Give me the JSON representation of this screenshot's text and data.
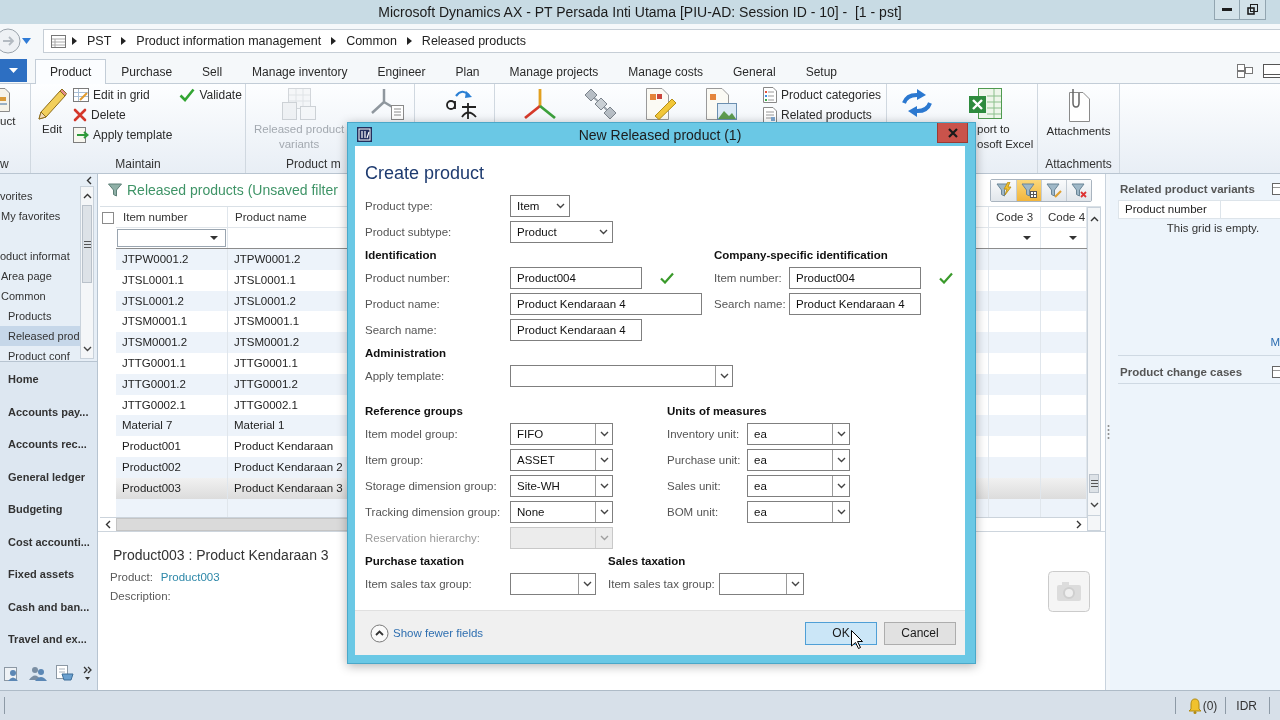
{
  "window": {
    "title": "Microsoft Dynamics AX - PT Persada Inti Utama [PIU-AD: Session ID - 10] -  [1 - pst]"
  },
  "address_bar": {
    "breadcrumb": [
      "PST",
      "Product information management",
      "Common",
      "Released products"
    ]
  },
  "ribbon": {
    "tabs": [
      {
        "label": "Product",
        "selected": true
      },
      {
        "label": "Purchase",
        "selected": false
      },
      {
        "label": "Sell",
        "selected": false
      },
      {
        "label": "Manage inventory",
        "selected": false
      },
      {
        "label": "Engineer",
        "selected": false
      },
      {
        "label": "Plan",
        "selected": false
      },
      {
        "label": "Manage projects",
        "selected": false
      },
      {
        "label": "Manage costs",
        "selected": false
      },
      {
        "label": "General",
        "selected": false
      },
      {
        "label": "Setup",
        "selected": false
      }
    ],
    "groups": [
      {
        "label": "w",
        "items": [
          {
            "kind": "large",
            "label": "uct",
            "disabled": false
          }
        ]
      },
      {
        "label": "Maintain",
        "items": [
          {
            "kind": "large",
            "label": "Edit",
            "disabled": false
          },
          {
            "kind": "small",
            "label": "Edit in grid",
            "disabled": false
          },
          {
            "kind": "small",
            "label": "Delete",
            "disabled": false
          },
          {
            "kind": "small",
            "label": "Apply template",
            "disabled": false
          },
          {
            "kind": "small",
            "label": "Validate",
            "disabled": false
          }
        ]
      },
      {
        "label": "Product m",
        "items": [
          {
            "kind": "large",
            "label": "Released product\nvariants",
            "disabled": true
          },
          {
            "kind": "icon",
            "disabled": false
          }
        ]
      },
      {
        "items": [
          {
            "kind": "icon",
            "disabled": false
          }
        ]
      },
      {
        "items": [
          {
            "kind": "icon",
            "disabled": false
          },
          {
            "kind": "icon",
            "disabled": false
          },
          {
            "kind": "icon",
            "disabled": false
          },
          {
            "kind": "icon",
            "disabled": false
          },
          {
            "kind": "small",
            "label": "Product categories",
            "disabled": false
          },
          {
            "kind": "small",
            "label": "Related products",
            "disabled": false
          }
        ]
      },
      {
        "items": [
          {
            "kind": "icon",
            "disabled": false
          },
          {
            "kind": "large",
            "label": "port to\nosoft Excel",
            "disabled": false
          }
        ]
      },
      {
        "label": "Attachments",
        "items": [
          {
            "kind": "large",
            "label": "Attachments",
            "disabled": false
          }
        ]
      }
    ]
  },
  "nav_pane": {
    "tree": [
      {
        "label": "vorites",
        "selected": false,
        "children": [
          {
            "label": "My favorites",
            "selected": false
          }
        ]
      },
      {
        "label": "oduct informat",
        "selected": false,
        "children": [
          {
            "label": "Area page",
            "selected": false
          },
          {
            "label": "Common",
            "selected": false,
            "children": [
              {
                "label": "Products",
                "selected": false
              },
              {
                "label": "Released prod",
                "selected": true
              },
              {
                "label": "Product conf",
                "selected": false
              }
            ]
          }
        ]
      }
    ],
    "modules": [
      "Home",
      "Accounts pay...",
      "Accounts rec...",
      "General ledger",
      "Budgeting",
      "Cost accounti...",
      "Fixed assets",
      "Cash and ban...",
      "Travel and ex..."
    ]
  },
  "grid": {
    "title": "Released products (Unsaved filter",
    "filter_buttons": [
      {
        "on": false
      },
      {
        "on": true
      },
      {
        "on": false
      },
      {
        "on": false
      }
    ],
    "select_all_checked": false,
    "columns": [
      "Item number",
      "Product name",
      "Code 3",
      "Code 4"
    ],
    "rows": [
      {
        "cells": [
          "JTPW0001.2",
          "JTPW0001.2"
        ],
        "selected": false
      },
      {
        "cells": [
          "JTSL0001.1",
          "JTSL0001.1"
        ],
        "selected": false
      },
      {
        "cells": [
          "JTSL0001.2",
          "JTSL0001.2"
        ],
        "selected": false
      },
      {
        "cells": [
          "JTSM0001.1",
          "JTSM0001.1"
        ],
        "selected": false
      },
      {
        "cells": [
          "JTSM0001.2",
          "JTSM0001.2"
        ],
        "selected": false
      },
      {
        "cells": [
          "JTTG0001.1",
          "JTTG0001.1"
        ],
        "selected": false
      },
      {
        "cells": [
          "JTTG0001.2",
          "JTTG0001.2"
        ],
        "selected": false
      },
      {
        "cells": [
          "JTTG0002.1",
          "JTTG0002.1"
        ],
        "selected": false
      },
      {
        "cells": [
          "Material 7",
          "Material 1"
        ],
        "selected": false
      },
      {
        "cells": [
          "Product001",
          "Product Kendaraan"
        ],
        "selected": false
      },
      {
        "cells": [
          "Product002",
          "Product Kendaraan 2"
        ],
        "selected": false
      },
      {
        "cells": [
          "Product003",
          "Product Kendaraan 3"
        ],
        "selected": true
      }
    ]
  },
  "details": {
    "heading": "Product003 : Product Kendaraan 3",
    "fields": [
      {
        "label": "Product:",
        "value": "Product003"
      },
      {
        "label": "Description:"
      }
    ]
  },
  "factboxes": [
    {
      "title": "Related product variants",
      "columns": [
        "Product number"
      ],
      "empty_text": "This grid is empty.",
      "link": "M"
    },
    {
      "title": "Product change cases"
    }
  ],
  "status_bar": {
    "notifications": "(0)",
    "currency": "IDR"
  },
  "dialog": {
    "title": "New Released product (1)",
    "heading": "Create product",
    "fields": [
      {
        "label": "Product type:",
        "kind": "select",
        "value": "Item"
      },
      {
        "label": "Product subtype:",
        "kind": "select",
        "value": "Product"
      }
    ],
    "sections": [
      {
        "groups": [
          {
            "title": "Identification",
            "fields": [
              {
                "label": "Product number:",
                "kind": "text",
                "value": "Product004",
                "validated": true
              },
              {
                "label": "Product name:",
                "kind": "text",
                "value": "Product Kendaraan 4",
                "validated": false
              },
              {
                "label": "Search name:",
                "kind": "text",
                "value": "Product Kendaraan 4",
                "validated": false
              }
            ]
          },
          {
            "title": "Company-specific identification",
            "fields": [
              {
                "label": "Item number:",
                "kind": "text",
                "value": "Product004",
                "validated": true
              },
              {
                "label": "Search name:",
                "kind": "text",
                "value": "Product Kendaraan 4",
                "validated": false
              }
            ]
          }
        ]
      },
      {
        "groups": [
          {
            "title": "Administration",
            "fields": [
              {
                "label": "Apply template:",
                "kind": "lookup"
              }
            ]
          }
        ]
      },
      {
        "groups": [
          {
            "title": "Reference groups",
            "fields": [
              {
                "label": "Item model group:",
                "kind": "lookup",
                "value": "FIFO",
                "disabled": false
              },
              {
                "label": "Item group:",
                "kind": "lookup",
                "value": "ASSET",
                "disabled": false
              },
              {
                "label": "Storage dimension group:",
                "kind": "lookup",
                "value": "Site-WH",
                "disabled": false
              },
              {
                "label": "Tracking dimension group:",
                "kind": "lookup",
                "value": "None",
                "disabled": false
              },
              {
                "label": "Reservation hierarchy:",
                "kind": "lookup",
                "disabled": true
              }
            ]
          },
          {
            "title": "Units of measures",
            "fields": [
              {
                "label": "Inventory unit:",
                "kind": "lookup",
                "value": "ea"
              },
              {
                "label": "Purchase unit:",
                "kind": "lookup",
                "value": "ea"
              },
              {
                "label": "Sales unit:",
                "kind": "lookup",
                "value": "ea"
              },
              {
                "label": "BOM unit:",
                "kind": "lookup",
                "value": "ea"
              }
            ]
          }
        ]
      },
      {
        "groups": [
          {
            "title": "Purchase taxation",
            "fields": [
              {
                "label": "Item sales tax group:",
                "kind": "lookup"
              }
            ]
          },
          {
            "title": "Sales taxation",
            "fields": [
              {
                "label": "Item sales tax group:",
                "kind": "lookup"
              }
            ]
          }
        ]
      }
    ],
    "toggle_link": "Show fewer fields",
    "buttons": [
      {
        "label": "OK",
        "focused": true
      },
      {
        "label": "Cancel",
        "focused": false
      }
    ]
  }
}
